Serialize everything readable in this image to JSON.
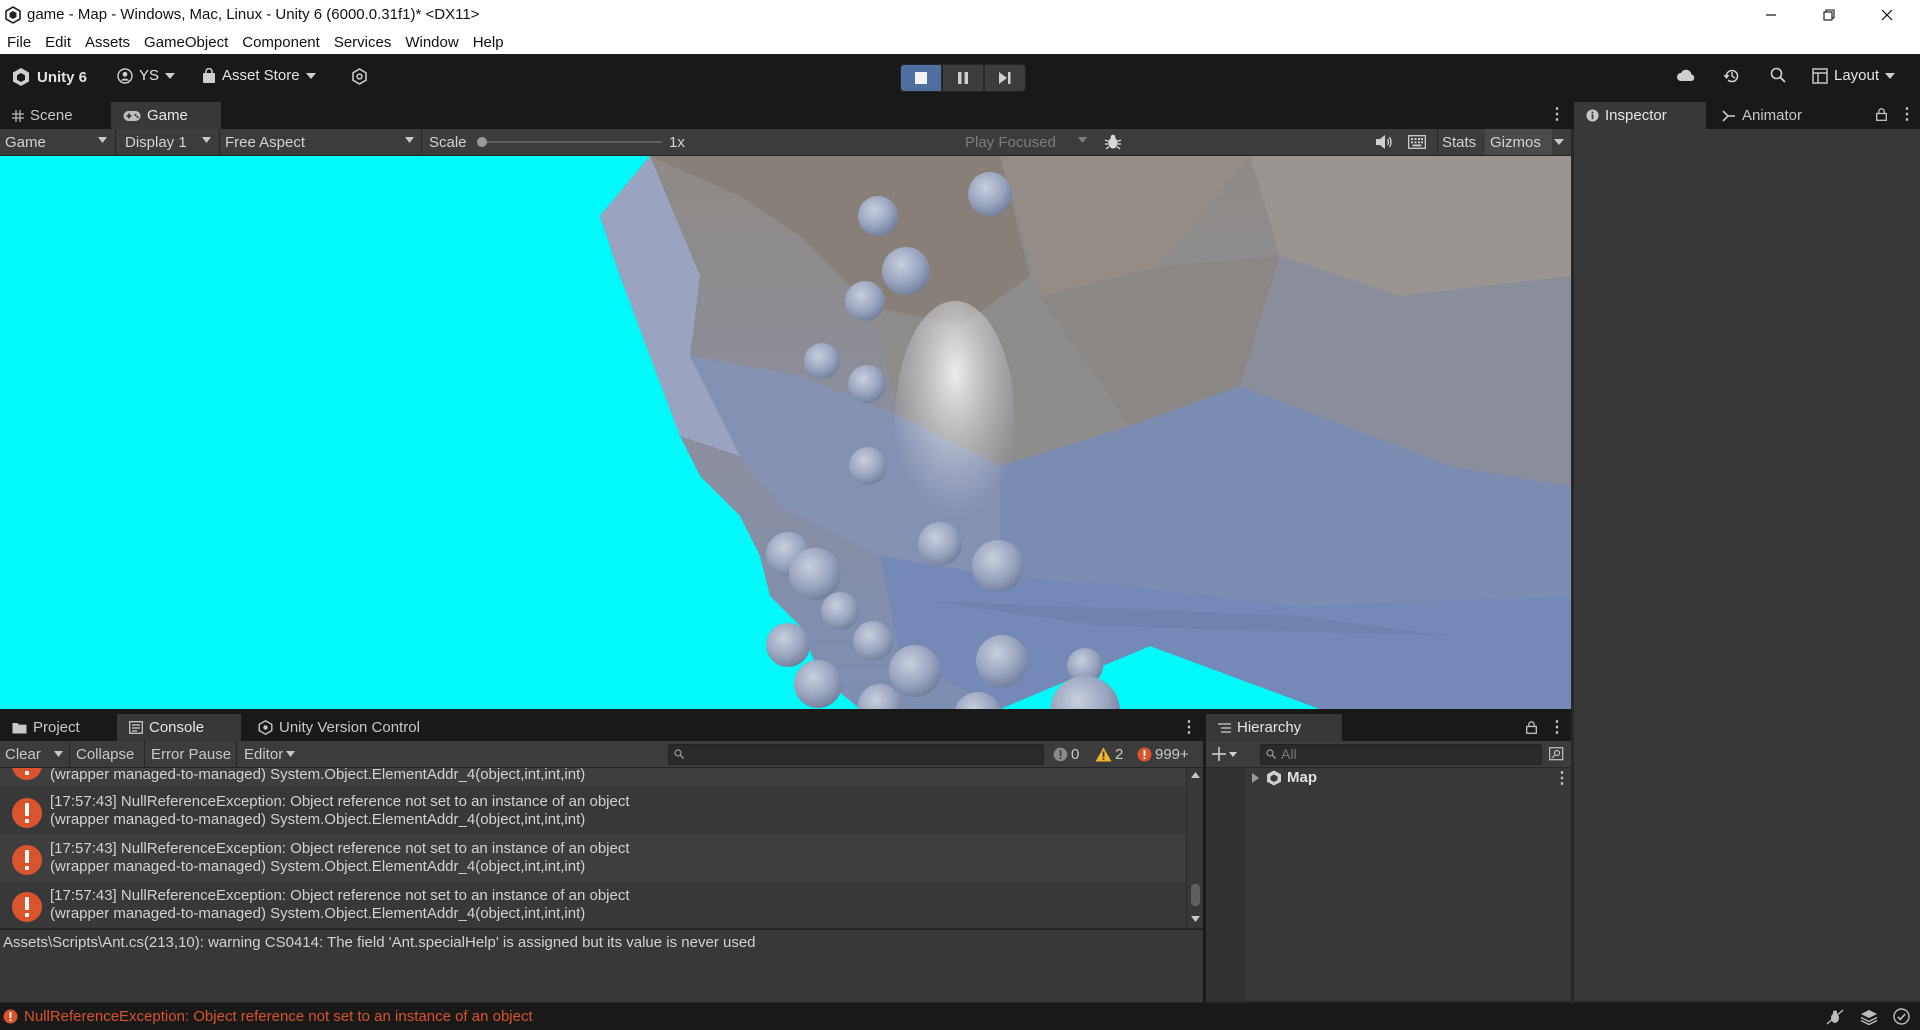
{
  "window": {
    "title": "game - Map - Windows, Mac, Linux - Unity 6 (6000.0.31f1)* <DX11>"
  },
  "menu": [
    "File",
    "Edit",
    "Assets",
    "GameObject",
    "Component",
    "Services",
    "Window",
    "Help"
  ],
  "toolbar": {
    "unity_label": "Unity 6",
    "account_label": "YS",
    "asset_store_label": "Asset Store",
    "layout_label": "Layout"
  },
  "scene_tabs": {
    "scene": "Scene",
    "game": "Game"
  },
  "right_tabs": {
    "inspector": "Inspector",
    "animator": "Animator"
  },
  "game_toolbar": {
    "view_mode": "Game",
    "display": "Display 1",
    "aspect": "Free Aspect",
    "scale_label": "Scale",
    "scale_value": "1x",
    "play_mode": "Play Focused",
    "stats": "Stats",
    "gizmos": "Gizmos"
  },
  "bottom_tabs": {
    "project": "Project",
    "console": "Console",
    "version_control": "Unity Version Control",
    "hierarchy": "Hierarchy"
  },
  "console": {
    "clear": "Clear",
    "collapse": "Collapse",
    "error_pause": "Error Pause",
    "editor": "Editor",
    "info_count": "0",
    "warning_count": "2",
    "error_count": "999+",
    "partial_row_line": "(wrapper managed-to-managed) System.Object.ElementAddr_4(object,int,int,int)",
    "rows": [
      {
        "line1": "[17:57:43] NullReferenceException: Object reference not set to an instance of an object",
        "line2": "(wrapper managed-to-managed) System.Object.ElementAddr_4(object,int,int,int)"
      },
      {
        "line1": "[17:57:43] NullReferenceException: Object reference not set to an instance of an object",
        "line2": "(wrapper managed-to-managed) System.Object.ElementAddr_4(object,int,int,int)"
      },
      {
        "line1": "[17:57:43] NullReferenceException: Object reference not set to an instance of an object",
        "line2": "(wrapper managed-to-managed) System.Object.ElementAddr_4(object,int,int,int)"
      }
    ],
    "detail": "Assets\\Scripts\\Ant.cs(213,10): warning CS0414: The field 'Ant.specialHelp' is assigned but its value is never used"
  },
  "hierarchy": {
    "search_placeholder": "All",
    "root_item": "Map"
  },
  "status": {
    "message": "NullReferenceException: Object reference not set to an instance of an object"
  },
  "colors": {
    "sky": "#00fafa",
    "error_red": "#d9532c",
    "warning_yellow": "#f0b429",
    "play_active": "#4f6fa0"
  }
}
